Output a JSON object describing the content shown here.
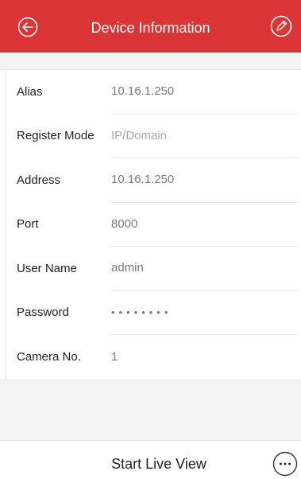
{
  "header": {
    "title": "Device Information",
    "background_color": "#da3437",
    "back_icon": "back-arrow-circle-icon",
    "edit_icon": "pencil-circle-icon"
  },
  "fields": [
    {
      "label": "Alias",
      "value": "10.16.1.250"
    },
    {
      "label": "Register Mode",
      "value": "IP/Domain"
    },
    {
      "label": "Address",
      "value": "10.16.1.250"
    },
    {
      "label": "Port",
      "value": "8000"
    },
    {
      "label": "User Name",
      "value": "admin"
    },
    {
      "label": "Password",
      "value": "••••••••"
    },
    {
      "label": "Camera No.",
      "value": "1"
    }
  ],
  "footer": {
    "live_view_label": "Start Live View",
    "more_icon": "ellipsis-circle-icon"
  }
}
